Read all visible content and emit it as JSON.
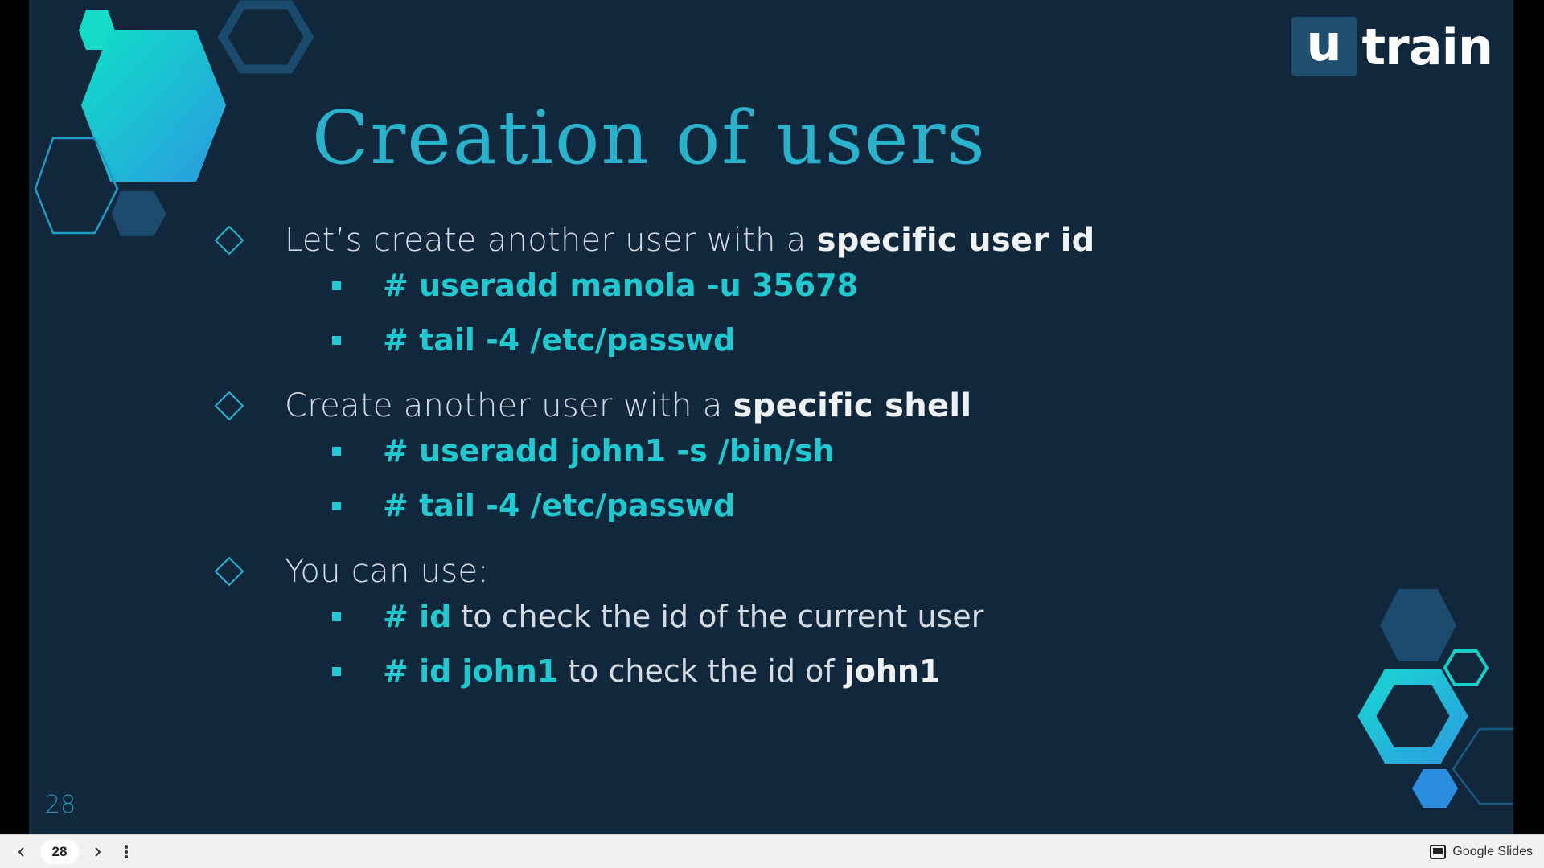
{
  "logo": {
    "part1": "u",
    "part2": "train"
  },
  "slide": {
    "title": "Creation of users",
    "page_number": "28",
    "items": [
      {
        "pre": "Let’s create another user with a ",
        "bold": "specific user id",
        "sub": [
          {
            "code": "# useradd manola -u 35678"
          },
          {
            "code": "# tail -4 /etc/passwd"
          }
        ]
      },
      {
        "pre": "Create another user with a ",
        "bold": "specific shell",
        "sub": [
          {
            "code": "# useradd john1 -s /bin/sh"
          },
          {
            "code": "# tail -4 /etc/passwd"
          }
        ]
      },
      {
        "pre": "You can use:",
        "bold": "",
        "sub": [
          {
            "code": "# id",
            "rest": " to check the id of the current user",
            "tail": ""
          },
          {
            "code": "# id john1",
            "rest": " to check the id of ",
            "tail": "john1"
          }
        ]
      }
    ]
  },
  "toolbar": {
    "current_page": "28",
    "app_name": "Google Slides",
    "prev_icon": "chevron-left-icon",
    "next_icon": "chevron-right-icon",
    "menu_icon": "more-vertical-icon",
    "brand_icon": "presentation-icon"
  },
  "colors": {
    "background": "#10273c",
    "title": "#2ab1cc",
    "code": "#22c8cf",
    "text": "#d5dbe3"
  }
}
